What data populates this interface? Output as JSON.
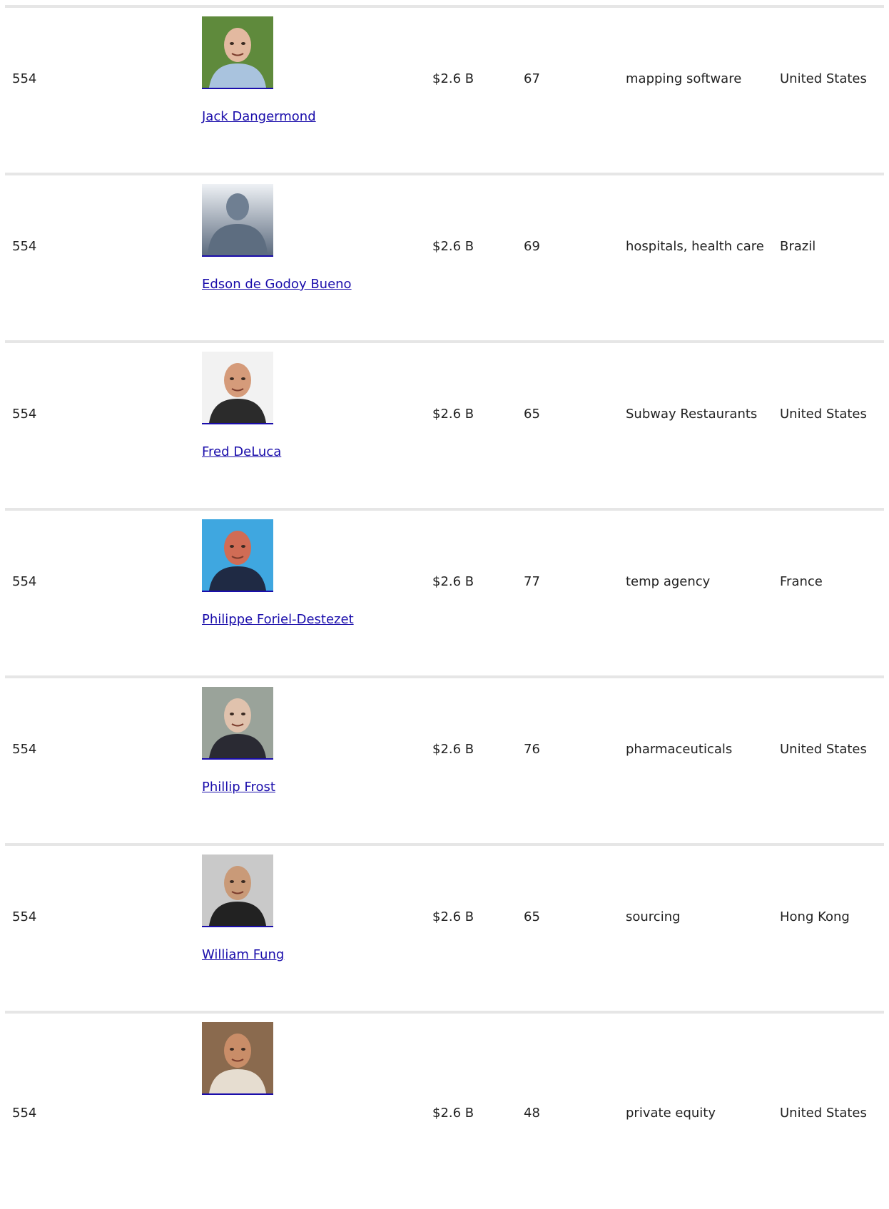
{
  "rows": [
    {
      "rank": "554",
      "name": "Jack Dangermond",
      "net_worth": "$2.6 B",
      "age": "67",
      "source": "mapping software",
      "country": "United States",
      "photo_icon": "person-photo",
      "photo_colors": {
        "bg": "#5f8a3c",
        "skin": "#e3b9a0",
        "shirt": "#a9c3de"
      }
    },
    {
      "rank": "554",
      "name": "Edson de Godoy Bueno",
      "net_worth": "$2.6 B",
      "age": "69",
      "source": "hospitals, health care",
      "country": "Brazil",
      "photo_icon": "placeholder-silhouette-icon",
      "photo_colors": {
        "bg": "#dfe5ec",
        "skin": "#6f7f92",
        "shirt": "#5d6d80"
      }
    },
    {
      "rank": "554",
      "name": "Fred DeLuca",
      "net_worth": "$2.6 B",
      "age": "65",
      "source": "Subway Restaurants",
      "country": "United States",
      "photo_icon": "person-photo",
      "photo_colors": {
        "bg": "#f2f2f2",
        "skin": "#d59b7a",
        "shirt": "#2b2b2b"
      }
    },
    {
      "rank": "554",
      "name": "Philippe Foriel-Destezet",
      "net_worth": "$2.6 B",
      "age": "77",
      "source": "temp agency",
      "country": "France",
      "photo_icon": "person-photo",
      "photo_colors": {
        "bg": "#3fa7e0",
        "skin": "#d06c55",
        "shirt": "#1f2a44"
      }
    },
    {
      "rank": "554",
      "name": "Phillip Frost",
      "net_worth": "$2.6 B",
      "age": "76",
      "source": "pharmaceuticals",
      "country": "United States",
      "photo_icon": "person-photo",
      "photo_colors": {
        "bg": "#9aa39a",
        "skin": "#e0c2ad",
        "shirt": "#2a2a33"
      }
    },
    {
      "rank": "554",
      "name": "William Fung",
      "net_worth": "$2.6 B",
      "age": "65",
      "source": "sourcing",
      "country": "Hong Kong",
      "photo_icon": "person-photo",
      "photo_colors": {
        "bg": "#c9c9c9",
        "skin": "#c99a78",
        "shirt": "#222222"
      }
    },
    {
      "rank": "554",
      "name": "",
      "net_worth": "$2.6 B",
      "age": "48",
      "source": "private equity",
      "country": "United States",
      "photo_icon": "person-photo",
      "photo_colors": {
        "bg": "#8a6a4e",
        "skin": "#c98d68",
        "shirt": "#e6ddd0"
      }
    }
  ]
}
